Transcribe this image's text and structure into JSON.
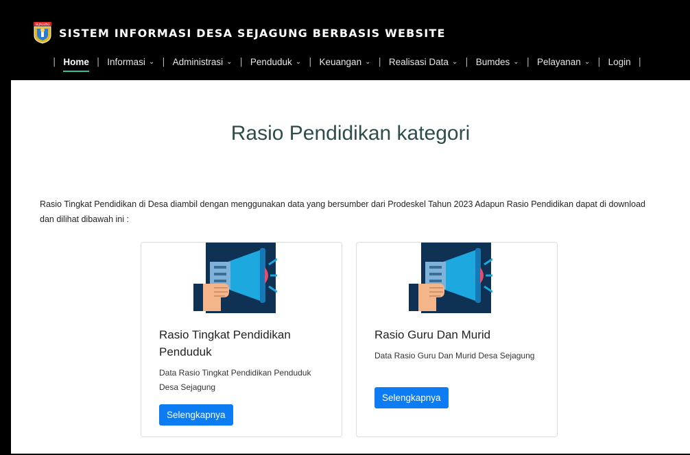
{
  "header": {
    "logo_text": "SEJAGUNG",
    "title": "SISTEM INFORMASI DESA SEJAGUNG BERBASIS WEBSITE"
  },
  "nav": {
    "items": [
      {
        "label": "Home",
        "has_dropdown": false,
        "active": true
      },
      {
        "label": "Informasi",
        "has_dropdown": true
      },
      {
        "label": "Administrasi",
        "has_dropdown": true
      },
      {
        "label": "Penduduk",
        "has_dropdown": true
      },
      {
        "label": "Keuangan",
        "has_dropdown": true
      },
      {
        "label": "Realisasi Data",
        "has_dropdown": true
      },
      {
        "label": "Bumdes",
        "has_dropdown": true
      },
      {
        "label": "Pelayanan",
        "has_dropdown": true
      },
      {
        "label": "Login",
        "has_dropdown": false
      }
    ],
    "separator": "|",
    "dropdown_icon": "chevron-down-icon"
  },
  "main": {
    "title": "Rasio Pendidikan kategori",
    "intro": "Rasio Tingkat Pendidikan di Desa diambil dengan menggunakan data yang bersumber dari Prodeskel Tahun 2023 Adapun Rasio Pendidikan dapat di download dan dilihat dibawah ini :",
    "cards": [
      {
        "title": "Rasio Tingkat Pendidikan Penduduk",
        "description": "Data Rasio Tingkat Pendidikan Penduduk Desa Sejagung",
        "button": "Selengkapnya",
        "icon": "megaphone-icon"
      },
      {
        "title": "Rasio Guru Dan Murid",
        "description": "Data Rasio Guru Dan Murid Desa Sejagung",
        "button": "Selengkapnya",
        "icon": "megaphone-icon"
      }
    ]
  },
  "colors": {
    "header_bg": "#000000",
    "active_underline": "#2ec4a0",
    "title_color": "#2f4c4c",
    "button_bg": "#0d7bf2",
    "icon_bg": "#0e3154",
    "megaphone_blue": "#1ea8e0"
  }
}
